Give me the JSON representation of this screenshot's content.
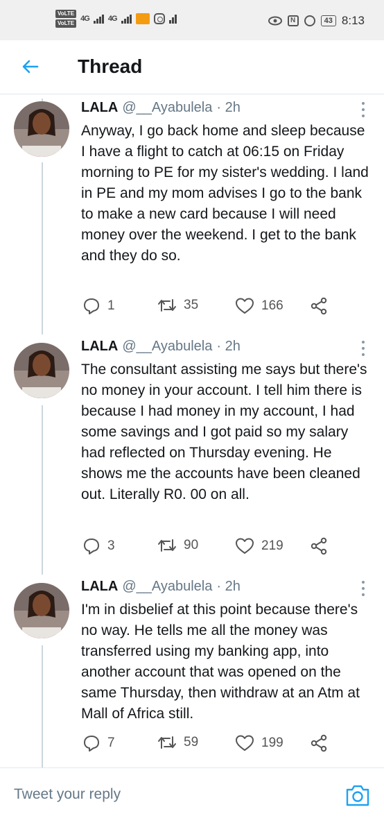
{
  "status_bar": {
    "volte1": "VoLTE",
    "volte2": "VoLTE",
    "net1": "4G",
    "net2": "4G",
    "battery": "43",
    "time": "8:13"
  },
  "header": {
    "title": "Thread"
  },
  "tweets": [
    {
      "name": "LALA",
      "handle": "@__Ayabulela",
      "time": "· 2h",
      "text": "Anyway, I go back home and sleep because I have a flight to catch at 06:15 on Friday morning to PE for my sister's wedding. I land in PE and my mom advises I go to the bank to make a new card because I will need money over the weekend. I get to the bank and they do so.",
      "replies": "1",
      "retweets": "35",
      "likes": "166"
    },
    {
      "name": "LALA",
      "handle": "@__Ayabulela",
      "time": "· 2h",
      "text": "The consultant assisting me says but there's no money in your account. I tell him there is because I had money in my account, I had some savings and I got paid so my salary had reflected on Thursday evening. He shows me the accounts have been cleaned out. Literally R0. 00 on all.",
      "replies": "3",
      "retweets": "90",
      "likes": "219"
    },
    {
      "name": "LALA",
      "handle": "@__Ayabulela",
      "time": "· 2h",
      "text": "I'm in disbelief at this point because there's no way. He tells me all the money was transferred using my banking app, into another account that was opened on the same Thursday, then withdraw at an Atm at Mall of Africa still.",
      "replies": "7",
      "retweets": "59",
      "likes": "199"
    }
  ],
  "reply": {
    "placeholder": "Tweet your reply"
  },
  "colors": {
    "accent": "#1da1f2",
    "text": "#14171a",
    "muted": "#657786",
    "divider": "#e1e8ed"
  }
}
